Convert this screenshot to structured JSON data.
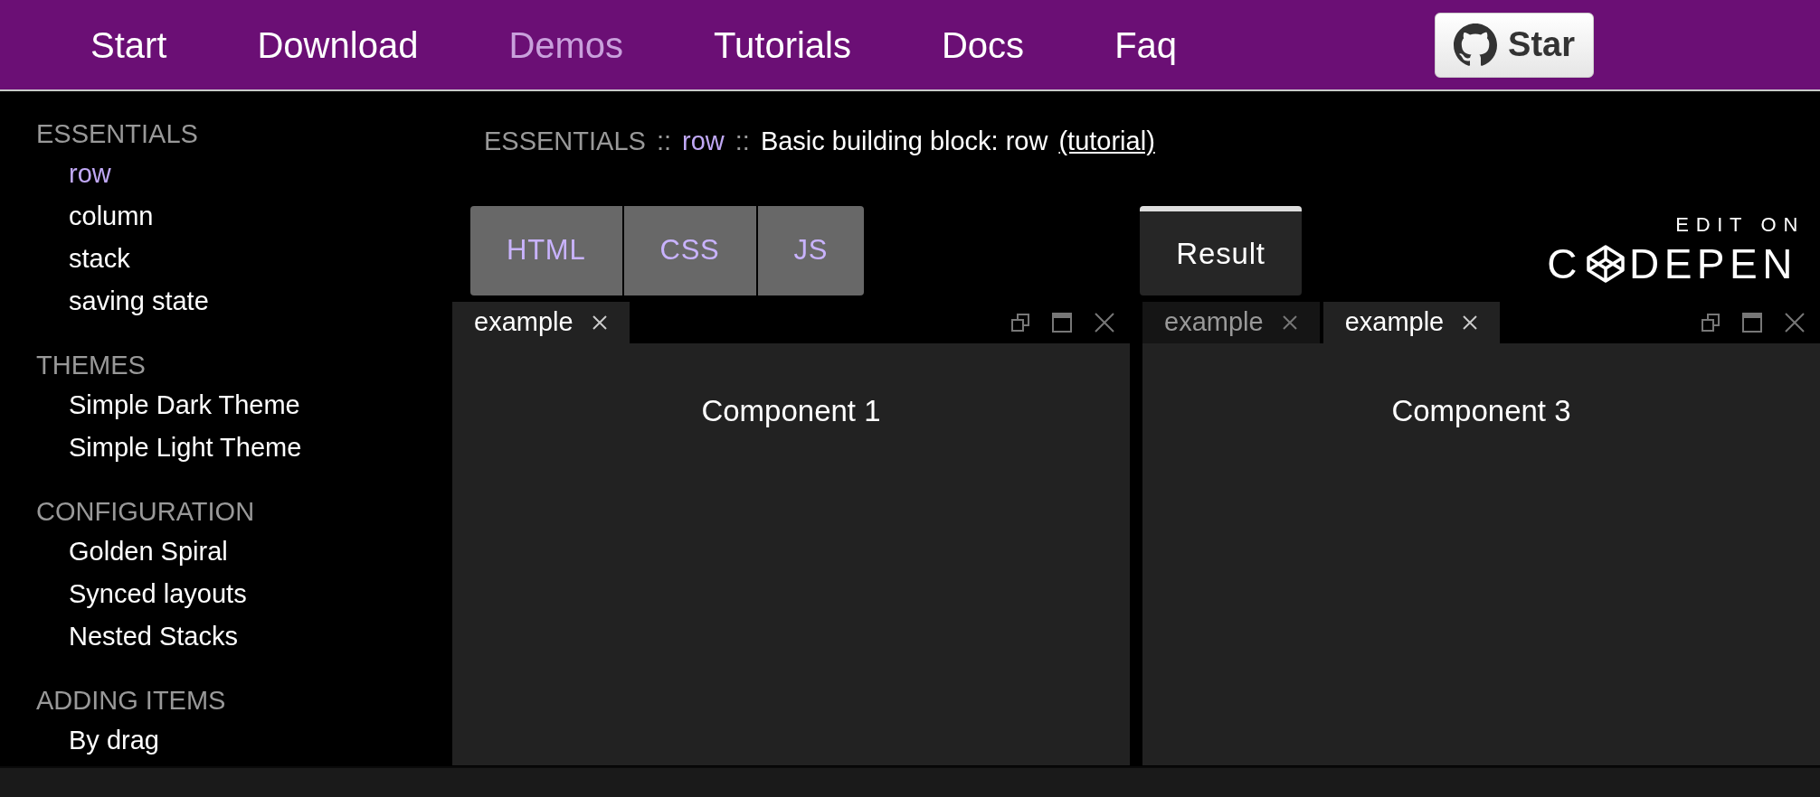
{
  "nav": {
    "items": [
      {
        "label": "Start",
        "selected": false
      },
      {
        "label": "Download",
        "selected": false
      },
      {
        "label": "Demos",
        "selected": true
      },
      {
        "label": "Tutorials",
        "selected": false
      },
      {
        "label": "Docs",
        "selected": false
      },
      {
        "label": "Faq",
        "selected": false
      }
    ],
    "star_button": "Star"
  },
  "sidebar": {
    "groups": [
      {
        "title": "ESSENTIALS",
        "items": [
          {
            "label": "row",
            "selected": true
          },
          {
            "label": "column",
            "selected": false
          },
          {
            "label": "stack",
            "selected": false
          },
          {
            "label": "saving state",
            "selected": false
          }
        ]
      },
      {
        "title": "THEMES",
        "items": [
          {
            "label": "Simple Dark Theme",
            "selected": false
          },
          {
            "label": "Simple Light Theme",
            "selected": false
          }
        ]
      },
      {
        "title": "CONFIGURATION",
        "items": [
          {
            "label": "Golden Spiral",
            "selected": false
          },
          {
            "label": "Synced layouts",
            "selected": false
          },
          {
            "label": "Nested Stacks",
            "selected": false
          }
        ]
      },
      {
        "title": "ADDING ITEMS",
        "items": [
          {
            "label": "By drag",
            "selected": false
          }
        ]
      }
    ]
  },
  "breadcrumb": {
    "section": "ESSENTIALS",
    "separator": "::",
    "item": "row",
    "title": "Basic building block: row",
    "link": "(tutorial)"
  },
  "codepen": {
    "tabs": [
      {
        "label": "HTML",
        "selected": false
      },
      {
        "label": "CSS",
        "selected": false
      },
      {
        "label": "JS",
        "selected": false
      },
      {
        "label": "Result",
        "selected": true
      }
    ],
    "caption": "EDIT ON",
    "logo_prefix": "C",
    "logo_suffix": "DEPEN"
  },
  "panes": [
    {
      "tabs": [
        {
          "label": "example",
          "selected": true
        }
      ],
      "content": "Component 1"
    },
    {
      "tabs": [
        {
          "label": "example",
          "selected": false
        },
        {
          "label": "example",
          "selected": true
        }
      ],
      "content": "Component 3"
    }
  ]
}
